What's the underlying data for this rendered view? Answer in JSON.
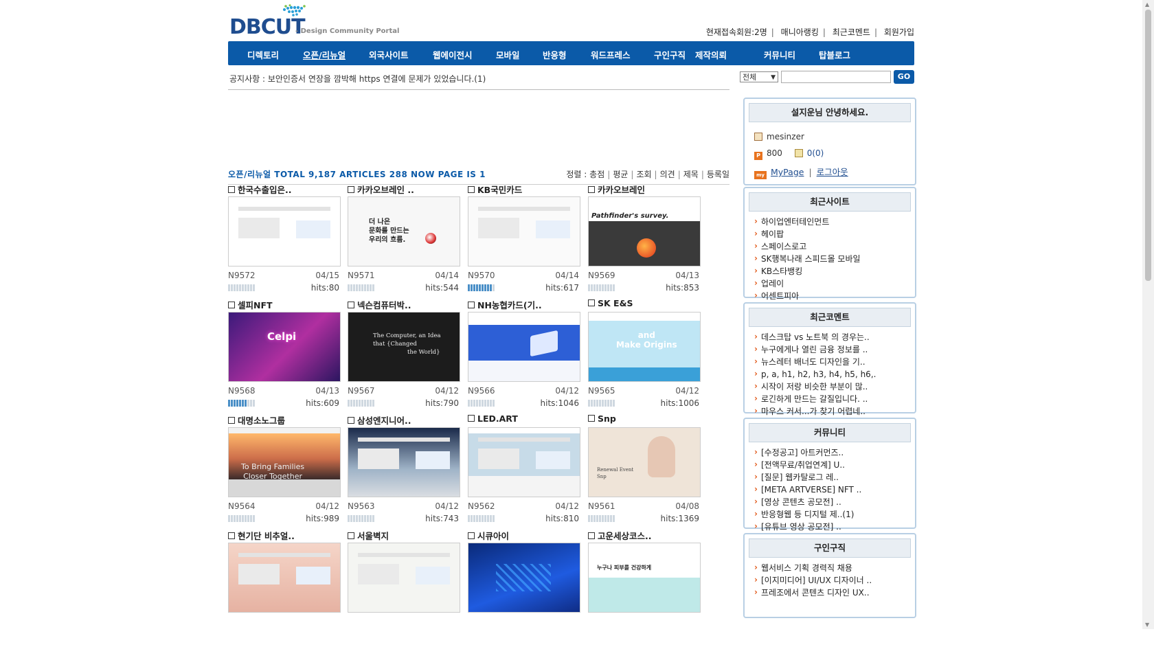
{
  "header": {
    "logo_text": "DBCUT",
    "logo_subtitle": "- Design Community Portal",
    "top_links": [
      "현재접속회원:2명",
      "매니아랭킹",
      "최근코멘트",
      "회원가입"
    ]
  },
  "nav": {
    "items": [
      "디렉토리",
      "오픈/리뉴얼",
      "외국사이트",
      "웹에이전시",
      "모바일",
      "반응형",
      "워드프레스",
      "구인구직",
      "제작의뢰",
      "커뮤니티",
      "탑블로그"
    ],
    "active_index": 1
  },
  "notice": "공지사항 : 보안인증서 연장을 깜박해 https 연결에 문제가 있었습니다.(1)",
  "search": {
    "select_value": "전체",
    "go_label": "GO"
  },
  "list": {
    "title": "오픈/리뉴얼 TOTAL 9,187 ARTICLES 288 NOW PAGE IS 1",
    "sort_label": "정렬 :",
    "sort_options": [
      "총점",
      "평균",
      "조회",
      "의견",
      "제목",
      "등록일"
    ]
  },
  "cards": [
    {
      "title": "한국수출입은..",
      "num": "N9572",
      "date": "04/15",
      "hits": "hits:80",
      "rating": 0
    },
    {
      "title": "카카오브레인 ..",
      "num": "N9571",
      "date": "04/14",
      "hits": "hits:544",
      "rating": 0
    },
    {
      "title": "KB국민카드",
      "num": "N9570",
      "date": "04/14",
      "hits": "hits:617",
      "rating": 9
    },
    {
      "title": "카카오브레인",
      "num": "N9569",
      "date": "04/13",
      "hits": "hits:853",
      "rating": 0
    },
    {
      "title": "셀피NFT",
      "num": "N9568",
      "date": "04/13",
      "hits": "hits:609",
      "rating": 7
    },
    {
      "title": "넥슨컴퓨터박..",
      "num": "N9567",
      "date": "04/12",
      "hits": "hits:790",
      "rating": 0
    },
    {
      "title": "NH농협카드(기..",
      "num": "N9566",
      "date": "04/12",
      "hits": "hits:1046",
      "rating": 0
    },
    {
      "title": "SK E&S",
      "num": "N9565",
      "date": "04/12",
      "hits": "hits:1006",
      "rating": 0
    },
    {
      "title": "대명소노그룹",
      "num": "N9564",
      "date": "04/12",
      "hits": "hits:989",
      "rating": 0
    },
    {
      "title": "삼성엔지니어..",
      "num": "N9563",
      "date": "04/12",
      "hits": "hits:743",
      "rating": 0
    },
    {
      "title": "LED.ART",
      "num": "N9562",
      "date": "04/12",
      "hits": "hits:810",
      "rating": 0
    },
    {
      "title": "Snp",
      "num": "N9561",
      "date": "04/08",
      "hits": "hits:1369",
      "rating": 0
    },
    {
      "title": "현기단 비추얼..",
      "num": "",
      "date": "",
      "hits": "",
      "rating": 0
    },
    {
      "title": "서울벽지",
      "num": "",
      "date": "",
      "hits": "",
      "rating": 0
    },
    {
      "title": "시큐아이",
      "num": "",
      "date": "",
      "hits": "",
      "rating": 0
    },
    {
      "title": "고운세상코스..",
      "num": "",
      "date": "",
      "hits": "",
      "rating": 0
    }
  ],
  "thumbs": {
    "t0": {
      "line1": "더 나은",
      "line2": "문화를 만드는",
      "line3": "우리의 흐름."
    },
    "t3": {
      "text": "Pathfinder's survey."
    },
    "t4": {
      "text": "Celpi"
    },
    "t5": {
      "line1": "The Computer, an Idea",
      "line2": "that  {Changed",
      "line3": "the World}"
    },
    "t7": {
      "line1": "and",
      "line2": "Make Origins"
    },
    "t8": {
      "line1": "To Bring Families",
      "line2": "Closer Together"
    },
    "t11": {
      "line1": "Renewal Event",
      "line2": "Snp"
    },
    "t15": {
      "text": "누구나 피부를 건강하게"
    }
  },
  "sidebar": {
    "login": {
      "greeting": "설지운님 안녕하세요.",
      "username": "mesinzer",
      "points": "800",
      "memo": "0(0)",
      "mypage": "MyPage",
      "logout": "로그아웃"
    },
    "recent_sites": {
      "title": "최근사이트",
      "items": [
        "하이업엔터테인먼트",
        "헤이팝",
        "스페이스로고",
        "SK행복나래 스피드몰 모바일",
        "KB스타뱅킹",
        "업레이",
        "어센트피아"
      ]
    },
    "recent_comments": {
      "title": "최근코멘트",
      "items": [
        "데스크탑 vs 노트북 의 경우는..",
        "누구에게나 열린 금융 정보를 ..",
        "뉴스레터 배너도 디자인을 기..",
        "p, a, h1, h2, h3, h4, h5, h6,.",
        "시작이 저랑 비슷한 부분이 많..",
        "로긴하게 만드는 갈질입니다. ..",
        "마우스 커서...가 찾기 어렵네.."
      ]
    },
    "community": {
      "title": "커뮤니티",
      "items": [
        "[수정공고] 아트커먼즈..",
        "[전액무료/취업연계] U..",
        "[질문] 웹카탈로그 레..",
        "[META ARTVERSE] NFT ..",
        "[영상 콘텐츠 공모전] ..",
        "반응형웹 등 디지털 제..(1)",
        "[유튜브 영상 공모전] .."
      ]
    },
    "jobs": {
      "title": "구인구직",
      "items": [
        "웹서비스 기획 경력직 채용",
        "[이지미디어] UI/UX 디자이너 ..",
        "프레조에서 콘텐츠 디자인 UX.."
      ]
    }
  },
  "colors": {
    "brand": "#0b5aa8",
    "accent": "#e25b1c",
    "box_border": "#b8cfe4"
  }
}
